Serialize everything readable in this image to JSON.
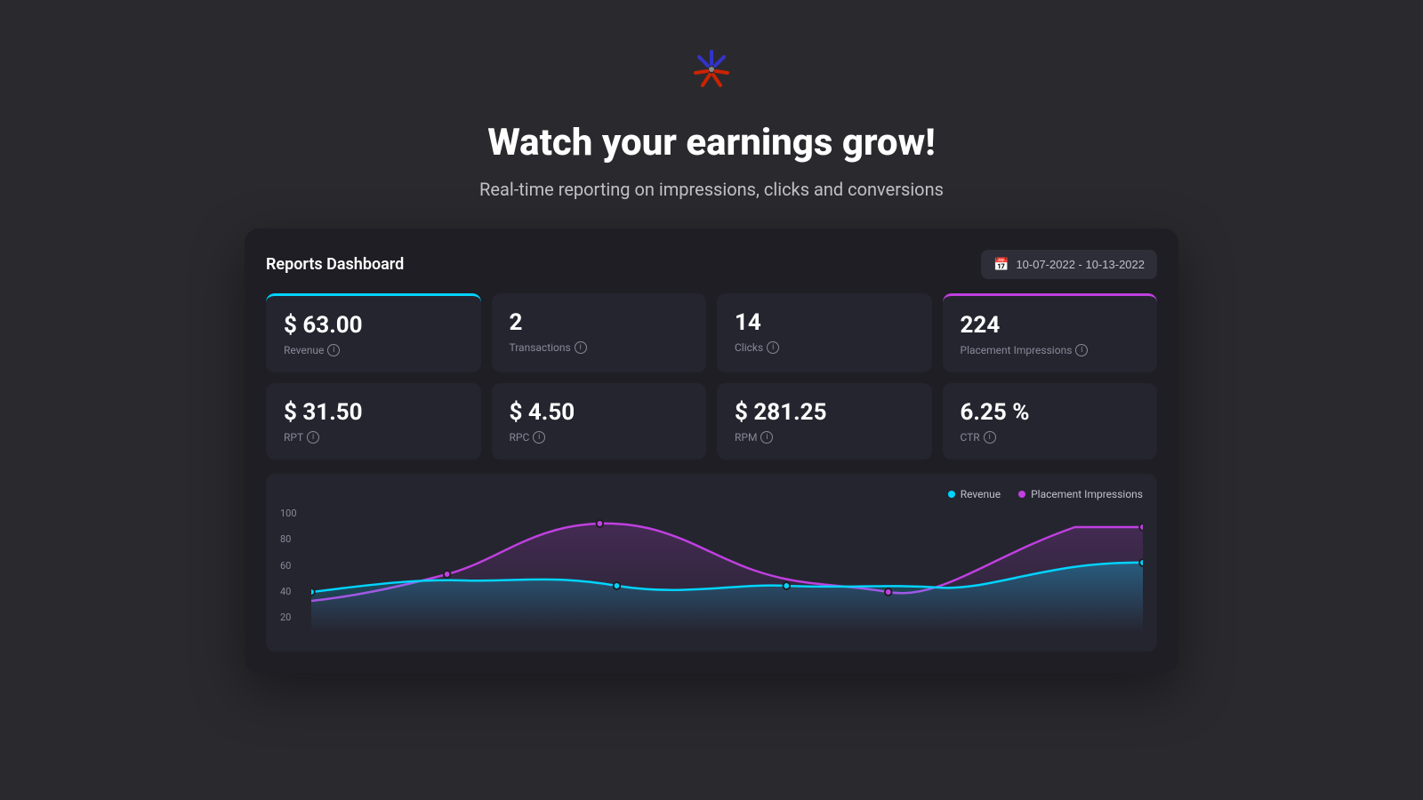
{
  "logo": {
    "alt": "Sparkle logo"
  },
  "hero": {
    "title": "Watch your earnings grow!",
    "subtitle": "Real-time reporting on impressions, clicks and conversions"
  },
  "dashboard": {
    "title": "Reports Dashboard",
    "date_range": "10-07-2022 - 10-13-2022",
    "metrics_top": [
      {
        "value": "$ 63.00",
        "label": "Revenue",
        "highlight": "cyan"
      },
      {
        "value": "2",
        "label": "Transactions",
        "highlight": "none"
      },
      {
        "value": "14",
        "label": "Clicks",
        "highlight": "none"
      },
      {
        "value": "224",
        "label": "Placement Impressions",
        "highlight": "purple"
      }
    ],
    "metrics_bottom": [
      {
        "value": "$ 31.50",
        "label": "RPT",
        "highlight": "none"
      },
      {
        "value": "$ 4.50",
        "label": "RPC",
        "highlight": "none"
      },
      {
        "value": "$ 281.25",
        "label": "RPM",
        "highlight": "none"
      },
      {
        "value": "6.25 %",
        "label": "CTR",
        "highlight": "none"
      }
    ],
    "chart": {
      "legend": [
        {
          "label": "Revenue",
          "color": "cyan"
        },
        {
          "label": "Placement Impressions",
          "color": "purple"
        }
      ],
      "y_labels": [
        "100",
        "80",
        "60",
        "40",
        "20"
      ]
    }
  }
}
